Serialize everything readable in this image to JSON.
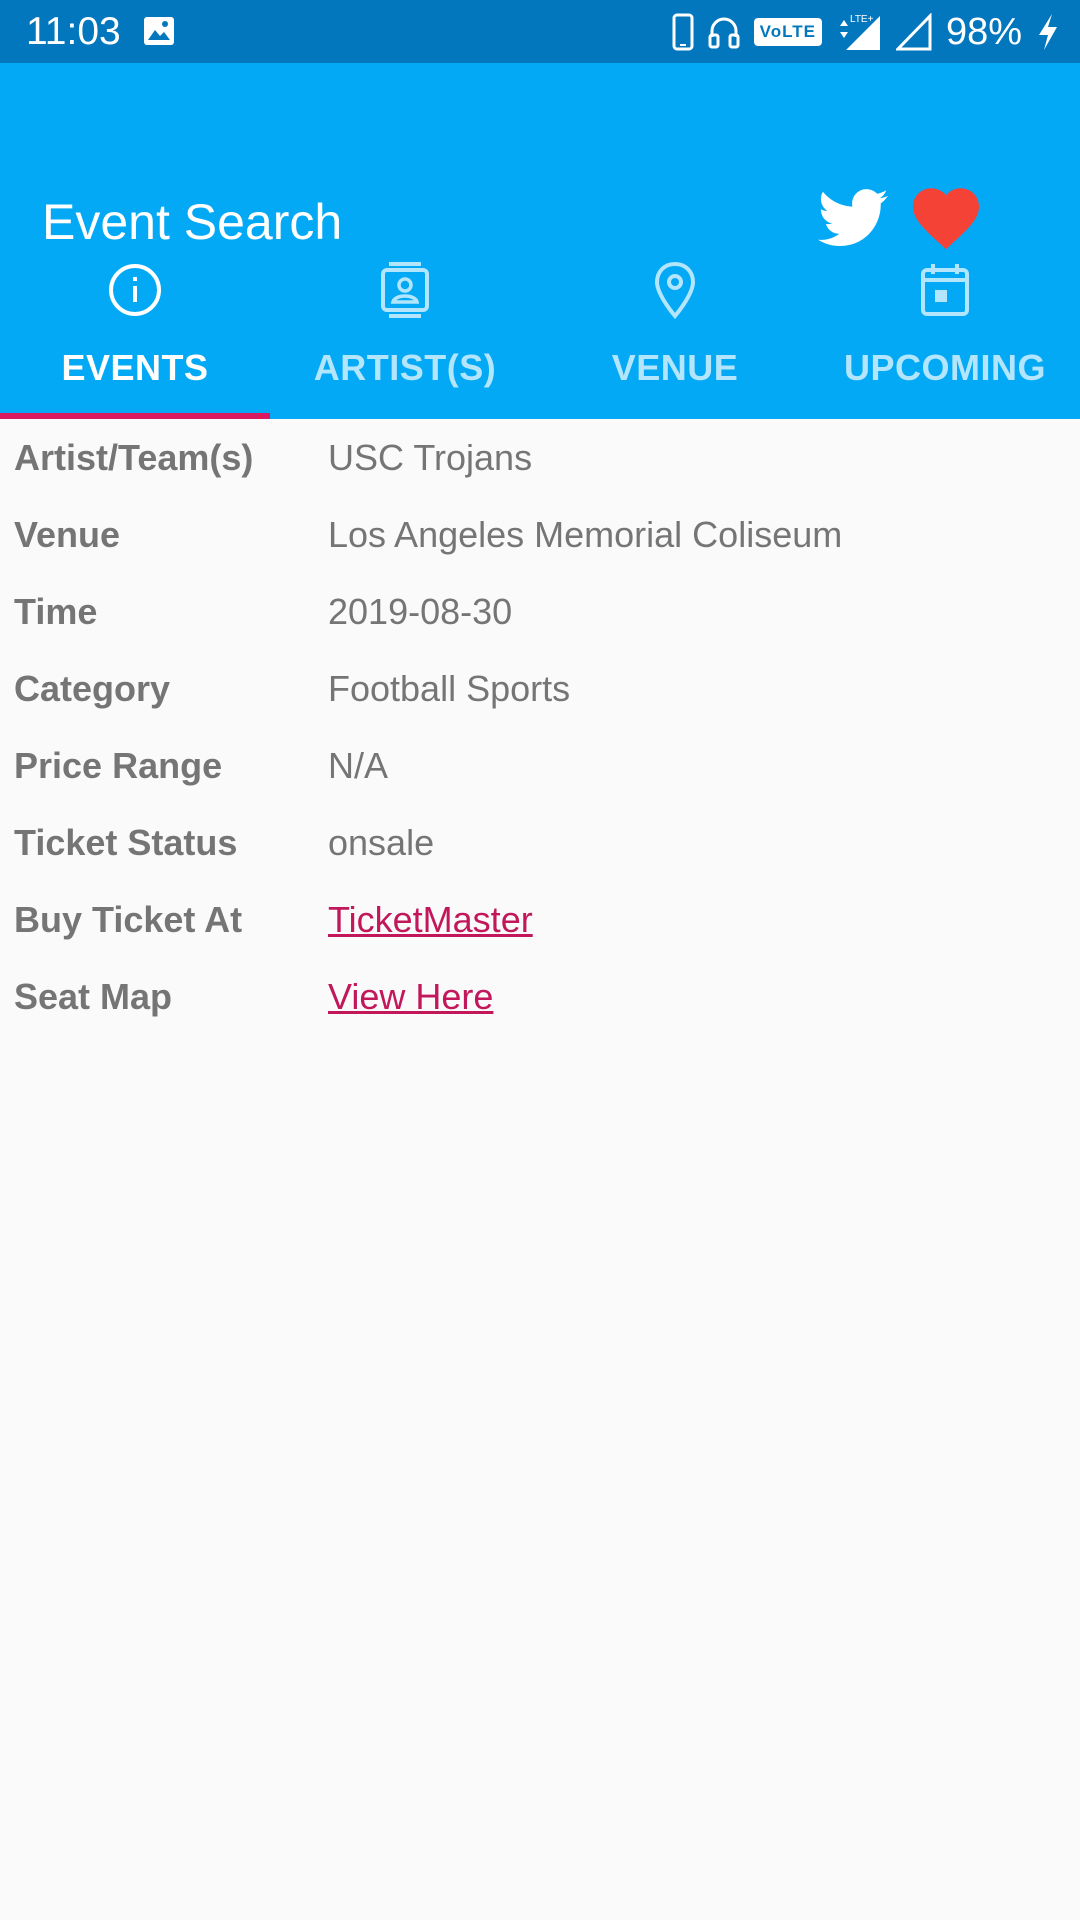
{
  "status_bar": {
    "time": "11:03",
    "battery": "98%",
    "network_badge": "VoLTE",
    "icons": [
      "image-icon",
      "phone-icon",
      "headphones-icon",
      "volte-icon",
      "signal-lte-icon",
      "signal-icon",
      "charging-icon"
    ]
  },
  "app_bar": {
    "title": "Event Search",
    "colors": {
      "primary": "#03a9f4",
      "primary_dark": "#0277bd",
      "accent": "#d81b60"
    },
    "actions": [
      {
        "name": "twitter-icon"
      },
      {
        "name": "heart-icon",
        "color": "#f44336"
      }
    ]
  },
  "tabs": [
    {
      "label": "EVENTS",
      "icon": "info-icon",
      "active": true
    },
    {
      "label": "ARTIST(S)",
      "icon": "contact-card-icon",
      "active": false
    },
    {
      "label": "VENUE",
      "icon": "location-pin-icon",
      "active": false
    },
    {
      "label": "UPCOMING",
      "icon": "calendar-icon",
      "active": false
    }
  ],
  "details": {
    "artist": {
      "label": "Artist/Team(s)",
      "value": "USC Trojans"
    },
    "venue": {
      "label": "Venue",
      "value": "Los Angeles Memorial Coliseum"
    },
    "time": {
      "label": "Time",
      "value": "2019-08-30"
    },
    "category": {
      "label": "Category",
      "value": "Football Sports"
    },
    "price_range": {
      "label": "Price Range",
      "value": "N/A"
    },
    "ticket_status": {
      "label": "Ticket Status",
      "value": "onsale"
    },
    "buy_ticket": {
      "label": "Buy Ticket At",
      "link_text": "TicketMaster"
    },
    "seat_map": {
      "label": "Seat Map",
      "link_text": "View Here"
    }
  }
}
